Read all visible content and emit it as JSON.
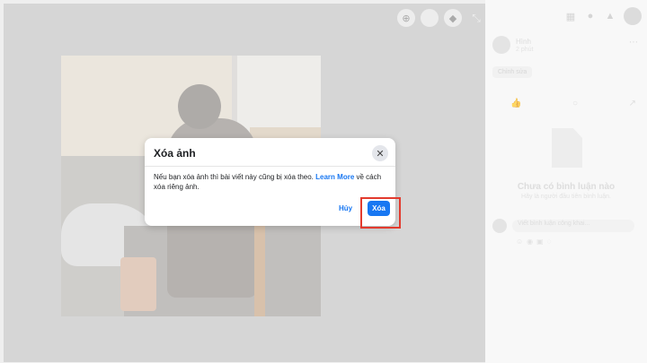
{
  "dialog": {
    "title": "Xóa ảnh",
    "close_icon": "close-icon",
    "body_prefix": "Nếu bạn xóa ảnh thì bài viết này cũng bị xóa theo.",
    "body_link": "Learn More",
    "body_suffix": "về cách xóa riêng ảnh.",
    "cancel_label": "Hủy",
    "delete_label": "Xóa"
  },
  "viewer": {
    "icons": [
      "zoom-in-icon",
      "blank-circle-icon",
      "tag-icon",
      "minimize-icon"
    ]
  },
  "sidebar": {
    "author": "Hình",
    "time": "2 phút",
    "edit_label": "Chỉnh sửa",
    "empty_title": "Chưa có bình luận nào",
    "empty_subtitle": "Hãy là người đầu tiên bình luận.",
    "comment_placeholder": "Viết bình luận công khai...",
    "top_icons": [
      "grid-icon",
      "messenger-icon",
      "bell-icon"
    ]
  },
  "colors": {
    "accent": "#1877f2",
    "highlight": "#e33b2e"
  }
}
